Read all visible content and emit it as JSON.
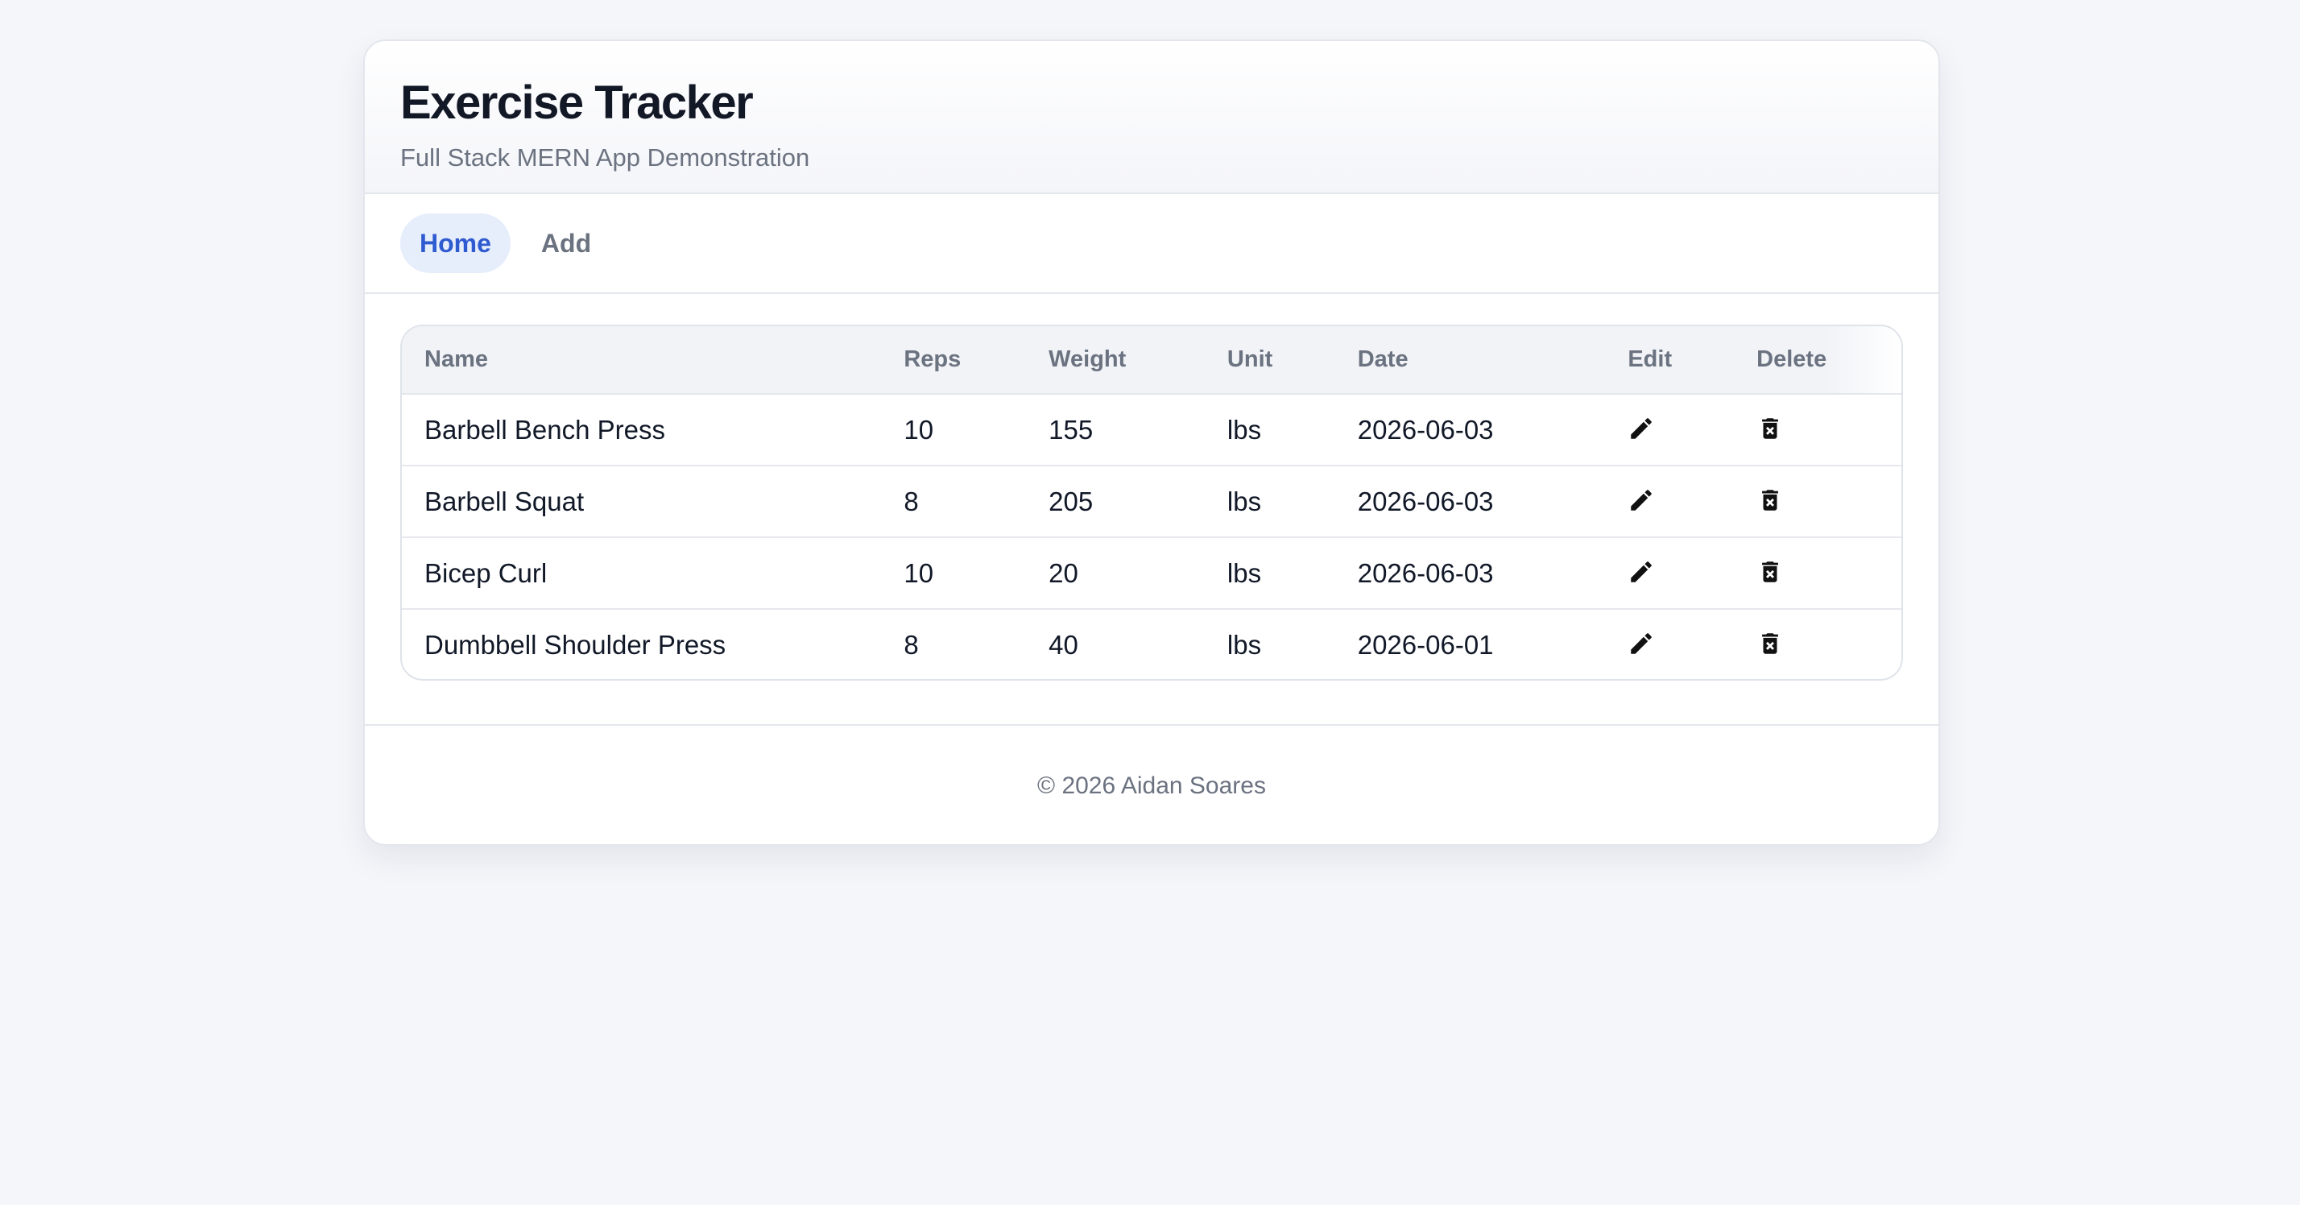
{
  "header": {
    "title": "Exercise Tracker",
    "subtitle": "Full Stack MERN App Demonstration"
  },
  "nav": {
    "items": [
      {
        "label": "Home",
        "active": true
      },
      {
        "label": "Add",
        "active": false
      }
    ]
  },
  "table": {
    "columns": [
      "Name",
      "Reps",
      "Weight",
      "Unit",
      "Date",
      "Edit",
      "Delete"
    ],
    "rows": [
      {
        "name": "Barbell Bench Press",
        "reps": "10",
        "weight": "155",
        "unit": "lbs",
        "date": "2026-06-03",
        "edit_icon": "pencil-icon",
        "delete_icon": "trash-icon"
      },
      {
        "name": "Barbell Squat",
        "reps": "8",
        "weight": "205",
        "unit": "lbs",
        "date": "2026-06-03",
        "edit_icon": "pencil-icon",
        "delete_icon": "trash-icon"
      },
      {
        "name": "Bicep Curl",
        "reps": "10",
        "weight": "20",
        "unit": "lbs",
        "date": "2026-06-03",
        "edit_icon": "pencil-icon",
        "delete_icon": "trash-icon"
      },
      {
        "name": "Dumbbell Shoulder Press",
        "reps": "8",
        "weight": "40",
        "unit": "lbs",
        "date": "2026-06-01",
        "edit_icon": "pencil-icon",
        "delete_icon": "trash-icon"
      }
    ]
  },
  "footer": {
    "text": "© 2026 Aidan Soares"
  },
  "colors": {
    "accent": "#2f5bd1",
    "accent_bg": "#e6edfb",
    "background": "#f5f6fa"
  }
}
